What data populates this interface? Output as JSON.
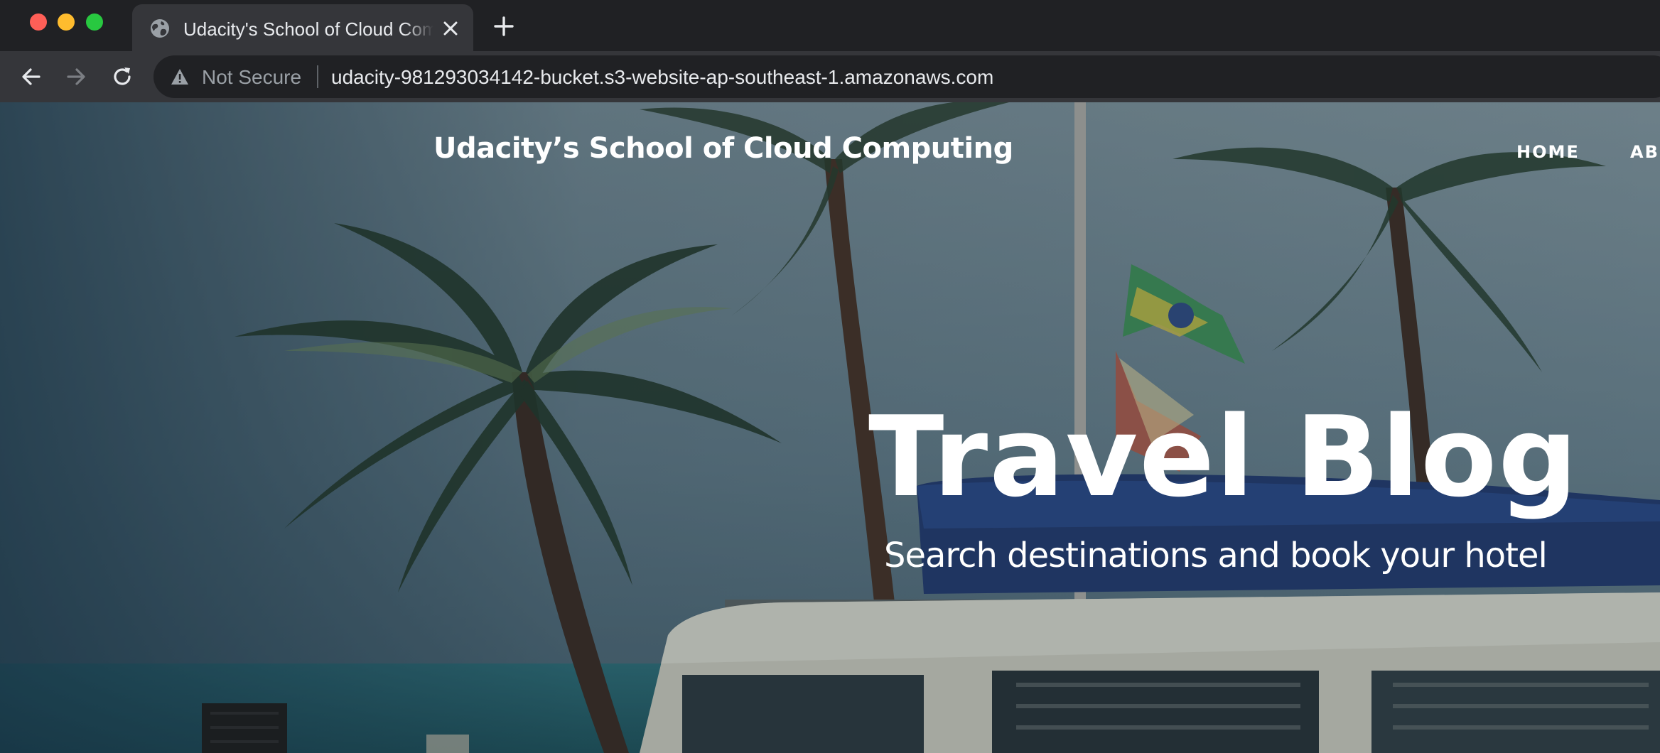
{
  "browser": {
    "window_controls": {
      "close_color": "#ff5f57",
      "minimize_color": "#febc2e",
      "zoom_color": "#28c840"
    },
    "tab": {
      "title": "Udacity's School of Cloud Computing",
      "favicon": "globe-icon",
      "close_icon": "close-icon"
    },
    "new_tab_icon": "plus-icon",
    "toolbar": {
      "back_icon": "arrow-left-icon",
      "forward_icon": "arrow-right-icon",
      "reload_icon": "reload-icon",
      "security_icon": "warning-triangle-icon",
      "security_label": "Not Secure",
      "url": "udacity-981293034142-bucket.s3-website-ap-southeast-1.amazonaws.com"
    }
  },
  "page": {
    "brand": "Udacity’s School of Cloud Computing",
    "nav": {
      "items": [
        {
          "label": "HOME"
        },
        {
          "label": "ABOUT"
        }
      ]
    },
    "hero": {
      "title": "Travel Blog",
      "subtitle": "Search destinations and book your hotel",
      "background": "beach-palm-trees-van-photo"
    }
  }
}
